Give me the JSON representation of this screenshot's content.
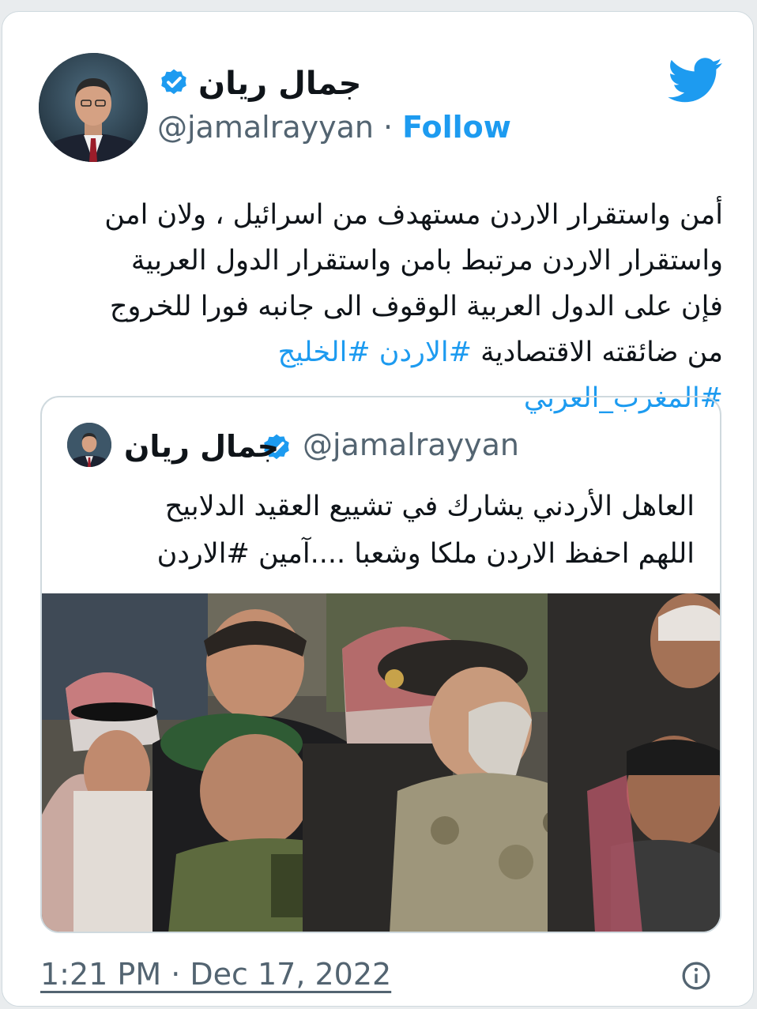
{
  "tweet": {
    "author": {
      "display_name": "جمال ريان",
      "handle": "@jamalrayyan",
      "verified": true,
      "separator": "·",
      "follow_label": "Follow"
    },
    "text": "أمن واستقرار الاردن مستهدف من اسرائيل ، ولان امن واستقرار الاردن مرتبط بامن واستقرار الدول العربية فإن على الدول العربية الوقوف الى جانبه فورا للخروج من ضائقته الاقتصادية",
    "hashtags": "#الاردن #الخليج #المغرب_العربي",
    "timestamp": "1:21 PM · Dec 17, 2022"
  },
  "quoted_tweet": {
    "display_name": "جمال ريان",
    "handle": "@jamalrayyan",
    "verified": true,
    "line1": "العاهل الأردني يشارك في تشييع العقيد الدلابيح",
    "line2": "اللهم احفظ الاردن ملكا وشعبا ....آمين",
    "line2_tag": "#الاردن"
  },
  "icons": {
    "brand": "twitter-bird-icon",
    "verified": "verified-badge-icon",
    "info": "info-icon"
  },
  "colors": {
    "accent": "#1d9bf0",
    "secondary_text": "#536471",
    "border": "#cfd9de"
  }
}
